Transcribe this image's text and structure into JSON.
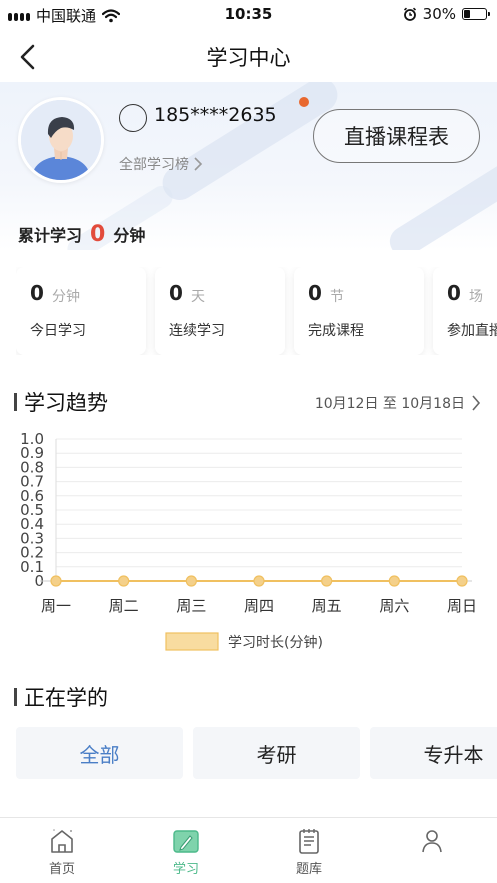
{
  "status_bar": {
    "carrier": "中国联通",
    "time": "10:35",
    "battery": "30%",
    "battery_level": 0.3
  },
  "nav": {
    "title": "学习中心"
  },
  "profile": {
    "phone": "185****2635",
    "rank_link": "全部学习榜",
    "live_button": "直播课程表"
  },
  "total": {
    "label": "累计学习",
    "value": "0",
    "unit": "分钟"
  },
  "stats": [
    {
      "value": "0",
      "unit": "分钟",
      "label": "今日学习"
    },
    {
      "value": "0",
      "unit": "天",
      "label": "连续学习"
    },
    {
      "value": "0",
      "unit": "节",
      "label": "完成课程"
    },
    {
      "value": "0",
      "unit": "场",
      "label": "参加直播"
    }
  ],
  "trend": {
    "title": "学习趋势",
    "date_range": "10月12日 至 10月18日"
  },
  "chart_data": {
    "type": "line",
    "categories": [
      "周一",
      "周二",
      "周三",
      "周四",
      "周五",
      "周六",
      "周日"
    ],
    "series": [
      {
        "name": "学习时长(分钟)",
        "values": [
          0,
          0,
          0,
          0,
          0,
          0,
          0
        ],
        "color": "#f0c060"
      }
    ],
    "yticks": [
      "0",
      "0.1",
      "0.2",
      "0.3",
      "0.4",
      "0.5",
      "0.6",
      "0.7",
      "0.8",
      "0.9",
      "1.0"
    ],
    "ylim": [
      0,
      1
    ],
    "grid": true,
    "legend": "bottom"
  },
  "learning": {
    "title": "正在学的",
    "tabs": [
      "全部",
      "考研",
      "专升本"
    ]
  },
  "bottom_nav": [
    {
      "label": "首页",
      "icon": "home-icon"
    },
    {
      "label": "学习",
      "icon": "study-icon"
    },
    {
      "label": "题库",
      "icon": "question-bank-icon"
    },
    {
      "label": "",
      "icon": "profile-icon"
    }
  ],
  "colors": {
    "accent_red": "#e24b3b",
    "accent_blue": "#4a7ec6",
    "accent_green": "#4cb98a",
    "series_line": "#f0c060"
  }
}
